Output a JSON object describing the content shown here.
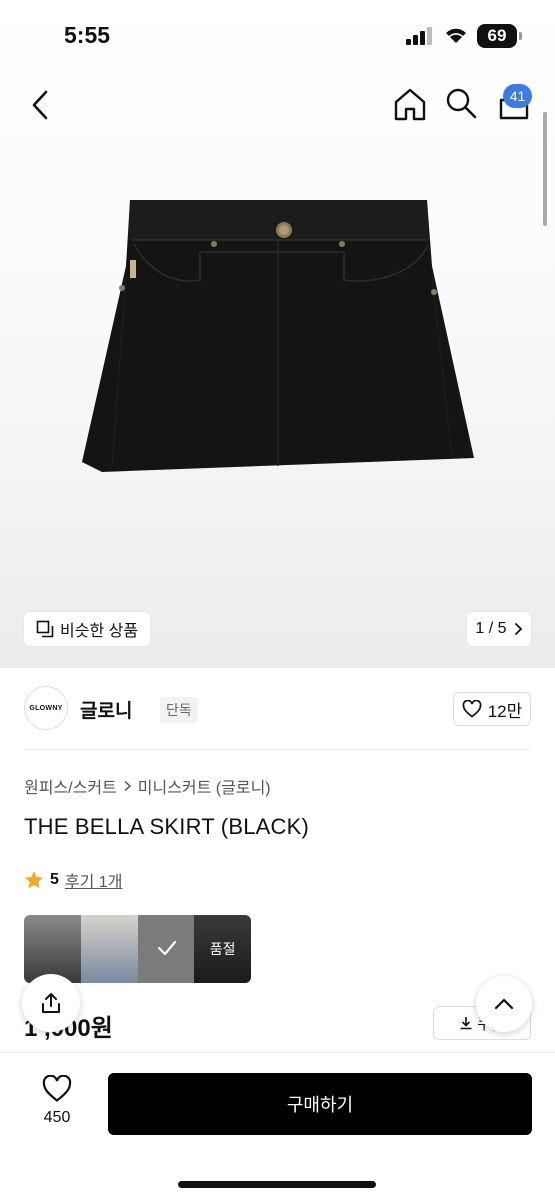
{
  "status": {
    "time": "5:55",
    "battery": "69"
  },
  "header": {
    "cart_count": "41"
  },
  "gallery": {
    "similar_label": "비슷한 상품",
    "pager": "1 / 5"
  },
  "brand": {
    "logo_text": "GLOWNY",
    "name": "글로니",
    "badge": "단독",
    "likes": "12만"
  },
  "breadcrumb": {
    "category": "원피스/스커트",
    "subcategory": "미니스커트 (글로니)"
  },
  "product": {
    "title": "THE BELLA SKIRT (BLACK)",
    "rating": "5",
    "reviews": "후기 1개",
    "price": "1 ,000원",
    "sold_out_label": "품절",
    "coupon_label": "쿠폰"
  },
  "bottom": {
    "wish_count": "450",
    "buy_label": "구매하기"
  }
}
